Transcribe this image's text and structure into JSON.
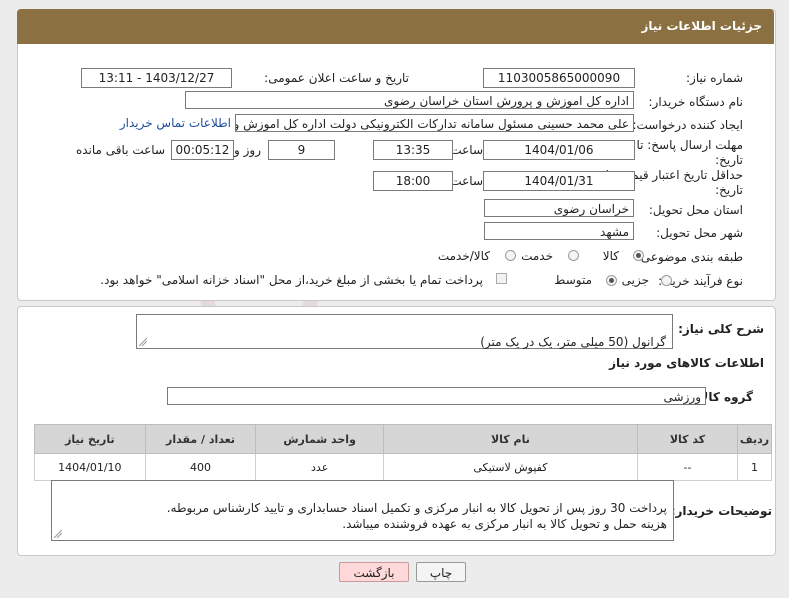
{
  "header": {
    "title": "جزئیات اطلاعات نیاز"
  },
  "form": {
    "need_number_label": "شماره نیاز:",
    "need_number": "1103005865000090",
    "announce_label": "تاریخ و ساعت اعلان عمومی:",
    "announce_value": "1403/12/27 - 13:11",
    "buyer_org_label": "نام دستگاه خریدار:",
    "buyer_org": "اداره کل اموزش و پرورش استان خراسان رضوی",
    "creator_label": "ایجاد کننده درخواست:",
    "creator": "علی محمد حسینی مسئول سامانه تدارکات الکترونیکی دولت اداره کل اموزش و",
    "contact_link": "اطلاعات تماس خریدار",
    "deadline_label_1": "مهلت ارسال پاسخ: تا",
    "deadline_label_2": "تاریخ:",
    "deadline_date": "1404/01/06",
    "time_label": "ساعت",
    "deadline_time": "13:35",
    "days_value": "9",
    "days_label": "روز و",
    "remaining_time": "00:05:12",
    "remaining_label": "ساعت باقی مانده",
    "validity_label_1": "حداقل تاریخ اعتبار قیمت: تا",
    "validity_label_2": "تاریخ:",
    "validity_date": "1404/01/31",
    "validity_time_label": "ساعت",
    "validity_time": "18:00",
    "province_label": "استان محل تحویل:",
    "province": "خراسان رضوی",
    "city_label": "شهر محل تحویل:",
    "city": "مشهد",
    "category_label": "طبقه بندی موضوعی:",
    "category_options": [
      "کالا",
      "خدمت",
      "کالا/خدمت"
    ],
    "process_label": "نوع فرآیند خرید :",
    "process_options": [
      "جزیی",
      "متوسط"
    ],
    "payment_note": "پرداخت تمام یا بخشی از مبلغ خرید،از محل \"اسناد خزانه اسلامی\" خواهد بود."
  },
  "details": {
    "summary_label": "شرح کلی نیاز:",
    "summary": "گرانول (50 میلی متر، یک در یک متر)",
    "goods_section_title": "اطلاعات کالاهای مورد نیاز",
    "goods_group_label": "گروه کالا:",
    "goods_group": "ورزشی",
    "table_headers": [
      "ردیف",
      "کد کالا",
      "نام کالا",
      "واحد شمارش",
      "تعداد / مقدار",
      "تاریخ نیاز"
    ],
    "rows": [
      {
        "row": "1",
        "code": "--",
        "name": "کفپوش لاستیکی",
        "unit": "عدد",
        "qty": "400",
        "date": "1404/01/10"
      }
    ],
    "buyer_notes_label": "توضیحات خریدار:",
    "buyer_notes": "پرداخت 30 روز پس از تحویل کالا به انبار مرکزی و تکمیل اسناد حسابداری و تایید کارشناس مربوطه.\nهزینه حمل و تحویل کالا به انبار مرکزی به عهده فروشنده میباشد."
  },
  "buttons": {
    "print": "چاپ",
    "back": "بازگشت"
  },
  "colors": {
    "header": "#8b7141",
    "link": "#1f4e9c",
    "back_button": "#ffd9d9"
  }
}
